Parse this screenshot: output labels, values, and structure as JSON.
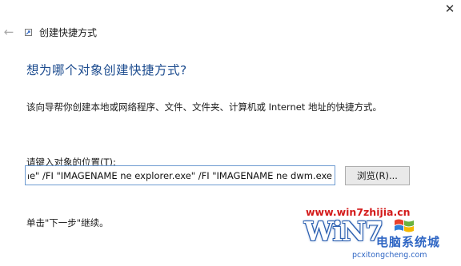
{
  "window": {
    "close_glyph": "✕"
  },
  "nav": {
    "back_glyph": "←",
    "title": "创建快捷方式"
  },
  "main": {
    "heading": "想为哪个对象创建快捷方式?",
    "description": "该向导帮你创建本地或网络程序、文件、文件夹、计算机或 Internet 地址的快捷方式。",
    "location_label": "请键入对象的位置(T):",
    "location_value": "ne\" /FI \"IMAGENAME ne explorer.exe\" /FI \"IMAGENAME ne dwm.exe",
    "browse_label": "浏览(R)...",
    "hint": "单击\"下一步\"继续。"
  },
  "watermark": {
    "url": "www.win7zhijia.cn",
    "logo": "WiN7",
    "cn_text": "电脑系统城",
    "domain": "pcxitongcheng.com"
  },
  "colors": {
    "heading": "#1d4c8f",
    "input_border": "#6e9bd1",
    "watermark_red": "#d41b1b",
    "watermark_blue": "#2f66c4"
  },
  "icons": {
    "back": "arrow-left-icon",
    "close": "close-icon",
    "wizard": "shortcut-icon"
  }
}
